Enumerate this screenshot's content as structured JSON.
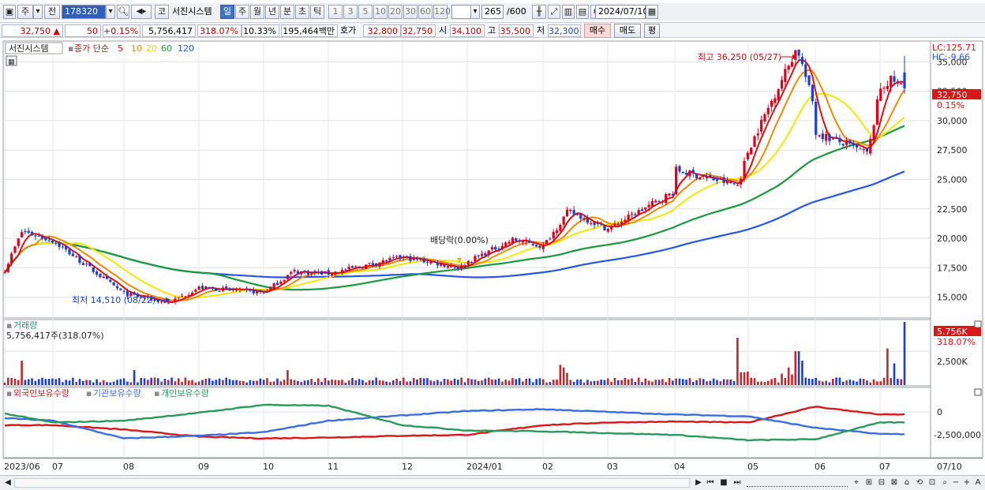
{
  "toolbar": {
    "mode": "주",
    "prev_label": "전",
    "code": "178320",
    "market_btn": "코",
    "stock_name": "서진시스템",
    "periods": [
      "일",
      "주",
      "월",
      "년",
      "분",
      "초",
      "틱"
    ],
    "active_period": "일",
    "intervals": [
      "1",
      "3",
      "5",
      "10",
      "20",
      "30",
      "60",
      "120"
    ],
    "count": "265",
    "count_total": "/600",
    "date": "2024/07/10"
  },
  "quote": {
    "price": "32,750",
    "change": "50",
    "change_pct": "+0.15%",
    "volume": "5,756,417",
    "volume_ratio": "318.07%",
    "turnover": "10.33%",
    "amount": "195,464백만",
    "hoga_label": "호가",
    "ask": "32,800",
    "bid": "32,750",
    "open_label": "시",
    "open": "34,100",
    "high_label": "고",
    "high": "35,500",
    "low_label": "저",
    "low": "32,300",
    "buy_label": "매수",
    "sell_label": "매도",
    "flat_label": "평"
  },
  "price_panel": {
    "legend_name": "서진시스템",
    "legend_ma_title": "종가 단순",
    "ma_periods": [
      "5",
      "10",
      "20",
      "60",
      "120"
    ],
    "lc_label": "LC:125.71",
    "hc_label": "HC:-9.66",
    "current_price_label": "32,750",
    "current_pct_label": "0.15%",
    "high_annotation": "최고 36,250 (05/27)",
    "low_annotation": "최저 14,510 (08/22)",
    "dividend_annotation": "배당락(0.00%)",
    "y_ticks": [
      "35,000",
      "32,500",
      "30,000",
      "27,500",
      "25,000",
      "22,500",
      "20,000",
      "17,500",
      "15,000"
    ]
  },
  "volume_panel": {
    "title": "거래량",
    "info": "5,756,417주(318.07%)",
    "current_label": "5.756K",
    "current_pct": "318.07%",
    "y_tick": "2,500K"
  },
  "holding_panel": {
    "series_names": [
      "외국인보유수량",
      "기관보유수량",
      "개인보유수량"
    ],
    "y_ticks": [
      "0",
      "-2,500,000"
    ]
  },
  "x_axis": {
    "labels": [
      "2023/06",
      "07",
      "08",
      "09",
      "10",
      "11",
      "12",
      "2024/01",
      "02",
      "03",
      "04",
      "05",
      "06",
      "07"
    ],
    "end_label": "07/10"
  },
  "colors": {
    "up": "#e0001b",
    "down": "#1a3fd8",
    "ma5": "#e01010",
    "ma10": "#f08a00",
    "ma20": "#f5e800",
    "ma60": "#189a3a",
    "ma120": "#2457e6",
    "foreign": "#d81818",
    "institution": "#3a6ee0",
    "individual": "#2a9a5a",
    "volume_bar": "#c0282c"
  },
  "chart_data": [
    {
      "type": "candlestick",
      "title": "서진시스템",
      "ylim": [
        13500,
        36500
      ],
      "yticks": [
        15000,
        17500,
        20000,
        22500,
        25000,
        27500,
        30000,
        32500,
        35000
      ],
      "ylabel_unit": "원",
      "x_start": "2023/06",
      "x_end": "2024/07/10",
      "months": [
        "2023/06",
        "07",
        "08",
        "09",
        "10",
        "11",
        "12",
        "2024/01",
        "02",
        "03",
        "04",
        "05",
        "06",
        "07"
      ],
      "monthly_close": [
        17300,
        19800,
        15300,
        15800,
        15400,
        17000,
        18400,
        18000,
        19300,
        20800,
        24000,
        27500,
        29000,
        32750
      ],
      "annotations": [
        {
          "text": "최고 36,250 (05/27)",
          "x": "2024/05/27",
          "y": 36250
        },
        {
          "text": "최저 14,510 (08/22)",
          "x": "2023/08/22",
          "y": 14510
        },
        {
          "text": "배당락(0.00%)",
          "x": "2023/12/27",
          "y": 17500
        }
      ],
      "last": {
        "price": 32750,
        "pct": 0.15,
        "open": 34100,
        "high": 35500,
        "low": 32300
      },
      "legend": [
        "종가 단순 5",
        "10",
        "20",
        "60",
        "120"
      ]
    },
    {
      "type": "bar",
      "title": "거래량",
      "ylim": [
        0,
        3500000
      ],
      "yticks": [
        2500000
      ],
      "last_value": 5756417,
      "last_pct": 318.07
    },
    {
      "type": "line",
      "series": [
        {
          "name": "외국인보유수량",
          "values": [
            -1500000,
            -1500000,
            -2000000,
            -2800000,
            -3000000,
            -2900000,
            -2700000,
            -2600000,
            -1500000,
            -1200000,
            -1100000,
            -1200000,
            600000,
            -300000
          ]
        },
        {
          "name": "기관보유수량",
          "values": [
            -700000,
            -1000000,
            -3000000,
            -2700000,
            -2300000,
            -1000000,
            -400000,
            100000,
            300000,
            0,
            -300000,
            -500000,
            -1800000,
            -2500000
          ]
        },
        {
          "name": "개인보유수량",
          "values": [
            -200000,
            -1200000,
            -1000000,
            -100000,
            800000,
            700000,
            -1500000,
            -2100000,
            -2200000,
            -2400000,
            -2600000,
            -3200000,
            -3100000,
            -1200000
          ]
        }
      ],
      "yticks": [
        0,
        -2500000
      ]
    }
  ]
}
